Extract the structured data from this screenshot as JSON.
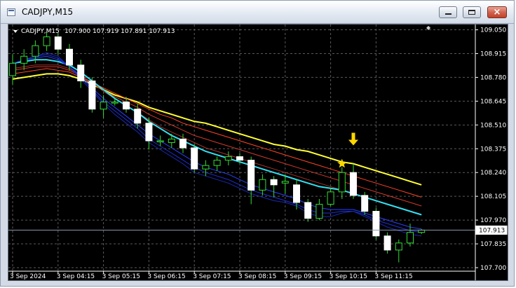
{
  "window": {
    "title": "CADJPY,M15",
    "buttons": {
      "minimize": "minimize",
      "maximize": "maximize",
      "close": "×"
    }
  },
  "chart_header": {
    "symbol_timeframe": "CADJPY,M15",
    "ohlc": "107.900 107.919 107.891 107.913"
  },
  "current_price_label": "107.913",
  "colors": {
    "background": "#000000",
    "grid": "#5a5a5a",
    "axis_text": "#ffffff",
    "bull_candle": "#000000",
    "bull_outline": "#33dd33",
    "bear_candle": "#ffffff",
    "wick": "#33dd33",
    "signal_arrow": "#ffd700",
    "signal_star": "#ffd700",
    "ema_long": "#ffff33",
    "ema_mid": "#33e0f0"
  },
  "chart_data": {
    "type": "candlestick",
    "y_ticks": [
      "109.050",
      "108.915",
      "108.780",
      "108.645",
      "108.510",
      "108.375",
      "108.240",
      "108.105",
      "107.970",
      "107.835",
      "107.700"
    ],
    "ylim": [
      107.68,
      109.08
    ],
    "x_ticks": [
      "3 Sep 2024",
      "3 Sep 04:15",
      "3 Sep 05:15",
      "3 Sep 06:15",
      "3 Sep 07:15",
      "3 Sep 08:15",
      "3 Sep 09:15",
      "3 Sep 10:15",
      "3 Sep 11:15"
    ],
    "candles": [
      {
        "o": 108.79,
        "c": 108.86,
        "h": 108.91,
        "l": 108.74
      },
      {
        "o": 108.86,
        "c": 108.9,
        "h": 108.94,
        "l": 108.82
      },
      {
        "o": 108.9,
        "c": 108.96,
        "h": 108.99,
        "l": 108.86
      },
      {
        "o": 108.96,
        "c": 109.01,
        "h": 109.04,
        "l": 108.93
      },
      {
        "o": 109.01,
        "c": 108.94,
        "h": 109.03,
        "l": 108.91
      },
      {
        "o": 108.94,
        "c": 108.85,
        "h": 108.97,
        "l": 108.82
      },
      {
        "o": 108.85,
        "c": 108.76,
        "h": 108.88,
        "l": 108.72
      },
      {
        "o": 108.76,
        "c": 108.6,
        "h": 108.78,
        "l": 108.58
      },
      {
        "o": 108.6,
        "c": 108.64,
        "h": 108.68,
        "l": 108.55
      },
      {
        "o": 108.64,
        "c": 108.64,
        "h": 108.66,
        "l": 108.62
      },
      {
        "o": 108.64,
        "c": 108.6,
        "h": 108.67,
        "l": 108.58
      },
      {
        "o": 108.6,
        "c": 108.52,
        "h": 108.63,
        "l": 108.49
      },
      {
        "o": 108.52,
        "c": 108.42,
        "h": 108.55,
        "l": 108.37
      },
      {
        "o": 108.42,
        "c": 108.42,
        "h": 108.45,
        "l": 108.39
      },
      {
        "o": 108.41,
        "c": 108.43,
        "h": 108.46,
        "l": 108.38
      },
      {
        "o": 108.43,
        "c": 108.38,
        "h": 108.46,
        "l": 108.35
      },
      {
        "o": 108.38,
        "c": 108.26,
        "h": 108.4,
        "l": 108.24
      },
      {
        "o": 108.26,
        "c": 108.28,
        "h": 108.31,
        "l": 108.22
      },
      {
        "o": 108.28,
        "c": 108.31,
        "h": 108.33,
        "l": 108.25
      },
      {
        "o": 108.31,
        "c": 108.33,
        "h": 108.36,
        "l": 108.28
      },
      {
        "o": 108.33,
        "c": 108.31,
        "h": 108.35,
        "l": 108.29
      },
      {
        "o": 108.31,
        "c": 108.14,
        "h": 108.33,
        "l": 108.06
      },
      {
        "o": 108.14,
        "c": 108.2,
        "h": 108.23,
        "l": 108.11
      },
      {
        "o": 108.2,
        "c": 108.17,
        "h": 108.22,
        "l": 108.1
      },
      {
        "o": 108.18,
        "c": 108.19,
        "h": 108.23,
        "l": 108.12
      },
      {
        "o": 108.17,
        "c": 108.07,
        "h": 108.2,
        "l": 108.03
      },
      {
        "o": 108.07,
        "c": 107.98,
        "h": 108.09,
        "l": 107.96
      },
      {
        "o": 107.98,
        "c": 108.06,
        "h": 108.09,
        "l": 107.97
      },
      {
        "o": 108.06,
        "c": 108.13,
        "h": 108.15,
        "l": 108.05
      },
      {
        "o": 108.13,
        "c": 108.24,
        "h": 108.27,
        "l": 108.09
      },
      {
        "o": 108.24,
        "c": 108.11,
        "h": 108.29,
        "l": 108.09
      },
      {
        "o": 108.11,
        "c": 108.02,
        "h": 108.13,
        "l": 108.0
      },
      {
        "o": 108.02,
        "c": 107.88,
        "h": 108.04,
        "l": 107.86
      },
      {
        "o": 107.88,
        "c": 107.8,
        "h": 107.9,
        "l": 107.78
      },
      {
        "o": 107.8,
        "c": 107.84,
        "h": 107.86,
        "l": 107.73
      },
      {
        "o": 107.84,
        "c": 107.9,
        "h": 107.95,
        "l": 107.82
      },
      {
        "o": 107.9,
        "c": 107.913,
        "h": 107.919,
        "l": 107.891
      }
    ],
    "ma_lines": [
      {
        "name": "",
        "color": "#ffff33",
        "width": 2,
        "values": [
          108.77,
          108.78,
          108.79,
          108.8,
          108.8,
          108.79,
          108.77,
          108.74,
          108.71,
          108.68,
          108.66,
          108.64,
          108.61,
          108.59,
          108.57,
          108.55,
          108.53,
          108.52,
          108.5,
          108.48,
          108.46,
          108.44,
          108.42,
          108.4,
          108.39,
          108.37,
          108.36,
          108.34,
          108.32,
          108.3,
          108.29,
          108.27,
          108.25,
          108.23,
          108.21,
          108.19,
          108.17
        ]
      },
      {
        "name": "",
        "color": "#ff4422",
        "width": 1,
        "values": [
          108.8,
          108.81,
          108.82,
          108.83,
          108.82,
          108.81,
          108.78,
          108.75,
          108.72,
          108.69,
          108.66,
          108.63,
          108.6,
          108.57,
          108.55,
          108.52,
          108.5,
          108.48,
          108.46,
          108.44,
          108.42,
          108.4,
          108.38,
          108.36,
          108.34,
          108.32,
          108.3,
          108.28,
          108.26,
          108.24,
          108.22,
          108.2,
          108.18,
          108.16,
          108.14,
          108.12,
          108.1
        ]
      },
      {
        "name": "",
        "color": "#d23a2a",
        "width": 1,
        "values": [
          108.82,
          108.83,
          108.84,
          108.84,
          108.84,
          108.82,
          108.79,
          108.75,
          108.71,
          108.67,
          108.64,
          108.61,
          108.57,
          108.54,
          108.51,
          108.48,
          108.45,
          108.43,
          108.41,
          108.39,
          108.37,
          108.35,
          108.33,
          108.31,
          108.29,
          108.27,
          108.25,
          108.23,
          108.21,
          108.19,
          108.17,
          108.15,
          108.13,
          108.11,
          108.09,
          108.07,
          108.05
        ]
      },
      {
        "name": "",
        "color": "#a83028",
        "width": 1,
        "values": [
          108.83,
          108.84,
          108.85,
          108.85,
          108.85,
          108.83,
          108.79,
          108.75,
          108.7,
          108.66,
          108.62,
          108.58,
          108.54,
          108.5,
          108.47,
          108.44,
          108.41,
          108.38,
          108.36,
          108.34,
          108.32,
          108.3,
          108.28,
          108.26,
          108.24,
          108.22,
          108.2,
          108.18,
          108.16,
          108.14,
          108.12,
          108.1,
          108.08,
          108.06,
          108.04,
          108.02,
          108.0
        ]
      },
      {
        "name": "",
        "color": "#33e0f0",
        "width": 2,
        "values": [
          108.86,
          108.87,
          108.88,
          108.88,
          108.87,
          108.85,
          108.81,
          108.76,
          108.71,
          108.66,
          108.62,
          108.58,
          108.53,
          108.49,
          108.45,
          108.42,
          108.39,
          108.36,
          108.34,
          108.32,
          108.3,
          108.28,
          108.26,
          108.24,
          108.22,
          108.2,
          108.18,
          108.16,
          108.15,
          108.14,
          108.12,
          108.1,
          108.08,
          108.06,
          108.04,
          108.02,
          108.0
        ]
      },
      {
        "name": "",
        "color": "#2a40ff",
        "width": 1,
        "values": [
          108.86,
          108.88,
          108.89,
          108.9,
          108.88,
          108.84,
          108.79,
          108.72,
          108.66,
          108.61,
          108.56,
          108.51,
          108.46,
          108.42,
          108.38,
          108.34,
          108.3,
          108.27,
          108.25,
          108.23,
          108.2,
          108.17,
          108.15,
          108.13,
          108.11,
          108.09,
          108.06,
          108.04,
          108.03,
          108.03,
          108.03,
          108.01,
          107.99,
          107.97,
          107.95,
          107.93,
          107.92
        ]
      },
      {
        "name": "",
        "color": "#1f2fd8",
        "width": 1,
        "values": [
          108.86,
          108.88,
          108.9,
          108.91,
          108.89,
          108.84,
          108.78,
          108.71,
          108.64,
          108.59,
          108.54,
          108.49,
          108.43,
          108.39,
          108.35,
          108.31,
          108.27,
          108.24,
          108.22,
          108.2,
          108.17,
          108.14,
          108.12,
          108.1,
          108.08,
          108.06,
          108.03,
          108.01,
          108.01,
          108.02,
          108.02,
          108.0,
          107.97,
          107.95,
          107.93,
          107.91,
          107.9
        ]
      },
      {
        "name": "",
        "color": "#1a28b0",
        "width": 1,
        "values": [
          108.86,
          108.88,
          108.9,
          108.92,
          108.9,
          108.84,
          108.77,
          108.7,
          108.63,
          108.57,
          108.52,
          108.47,
          108.41,
          108.37,
          108.33,
          108.29,
          108.24,
          108.22,
          108.2,
          108.18,
          108.15,
          108.12,
          108.1,
          108.08,
          108.07,
          108.05,
          108.01,
          107.99,
          107.99,
          108.01,
          108.02,
          107.99,
          107.96,
          107.93,
          107.91,
          107.89,
          107.88
        ]
      }
    ],
    "signals": [
      {
        "type": "down-arrow",
        "index": 30,
        "price": 108.41
      },
      {
        "type": "star",
        "index": 29,
        "price": 108.29
      }
    ]
  }
}
